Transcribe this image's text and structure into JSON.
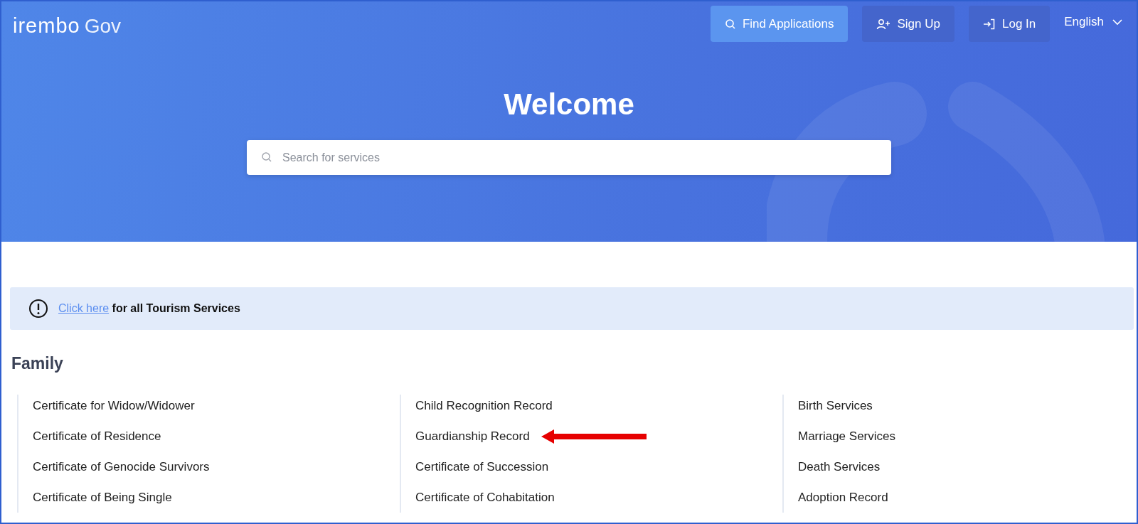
{
  "logo": {
    "brand": "irembo",
    "suffix": "Gov"
  },
  "nav": {
    "buttons": [
      {
        "kind": "search",
        "label": "Find Applications"
      },
      {
        "kind": "signup",
        "label": "Sign Up"
      },
      {
        "kind": "login",
        "label": "Log In"
      }
    ],
    "language": "English"
  },
  "hero": {
    "title": "Welcome",
    "search": {
      "placeholder": "Search for services"
    }
  },
  "notice": {
    "link": "Click here",
    "text": "for all Tourism Services"
  },
  "section": {
    "title": "Family",
    "columns": [
      [
        {
          "label": "Certificate for Widow/Widower",
          "annotated": false
        },
        {
          "label": "Certificate of Residence",
          "annotated": false
        },
        {
          "label": "Certificate of Genocide Survivors",
          "annotated": false
        },
        {
          "label": "Certificate of Being Single",
          "annotated": false
        }
      ],
      [
        {
          "label": "Child Recognition Record",
          "annotated": false
        },
        {
          "label": "Guardianship Record",
          "annotated": true
        },
        {
          "label": "Certificate of Succession",
          "annotated": false
        },
        {
          "label": "Certificate of Cohabitation",
          "annotated": false
        }
      ],
      [
        {
          "label": "Birth Services",
          "annotated": false
        },
        {
          "label": "Marriage Services",
          "annotated": false
        },
        {
          "label": "Death Services",
          "annotated": false
        },
        {
          "label": "Adoption Record",
          "annotated": false
        }
      ]
    ]
  }
}
